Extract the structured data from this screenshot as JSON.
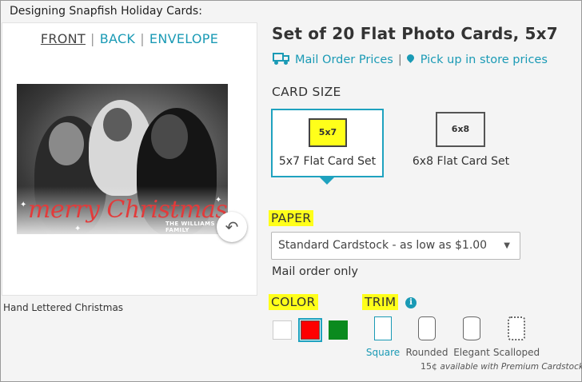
{
  "caption": "Designing Snapfish Holiday Cards:",
  "preview": {
    "tabs": [
      "FRONT",
      "BACK",
      "ENVELOPE"
    ],
    "card_script": "merry Christmas",
    "card_family": "THE WILLIAMS FAMILY",
    "design_name": "Hand Lettered Christmas"
  },
  "product": {
    "title": "Set of 20 Flat Photo Cards, 5x7",
    "mail_order_link": "Mail Order Prices",
    "pickup_link": "Pick up in store prices"
  },
  "card_size": {
    "label": "CARD SIZE",
    "options": [
      {
        "thumb": "5x7",
        "label": "5x7 Flat Card Set",
        "selected": true
      },
      {
        "thumb": "6x8",
        "label": "6x8 Flat Card Set",
        "selected": false
      }
    ]
  },
  "paper": {
    "label": "PAPER",
    "selected": "Standard Cardstock - as low as $1.00",
    "note": "Mail order only"
  },
  "color": {
    "label": "COLOR",
    "swatches": [
      {
        "name": "white",
        "hex": "#ffffff",
        "selected": false
      },
      {
        "name": "red",
        "hex": "#ff0000",
        "selected": true
      },
      {
        "name": "green",
        "hex": "#0a8a1e",
        "selected": false
      }
    ]
  },
  "trim": {
    "label": "TRIM",
    "options": [
      {
        "label": "Square",
        "selected": true
      },
      {
        "label": "Rounded",
        "selected": false
      },
      {
        "label": "Elegant",
        "selected": false
      },
      {
        "label": "Scalloped",
        "selected": false
      }
    ],
    "price": "15¢",
    "price_note": "available with Premium Cardstock"
  },
  "colors": {
    "accent": "#1a9ab5",
    "highlight": "#ffff1a"
  }
}
